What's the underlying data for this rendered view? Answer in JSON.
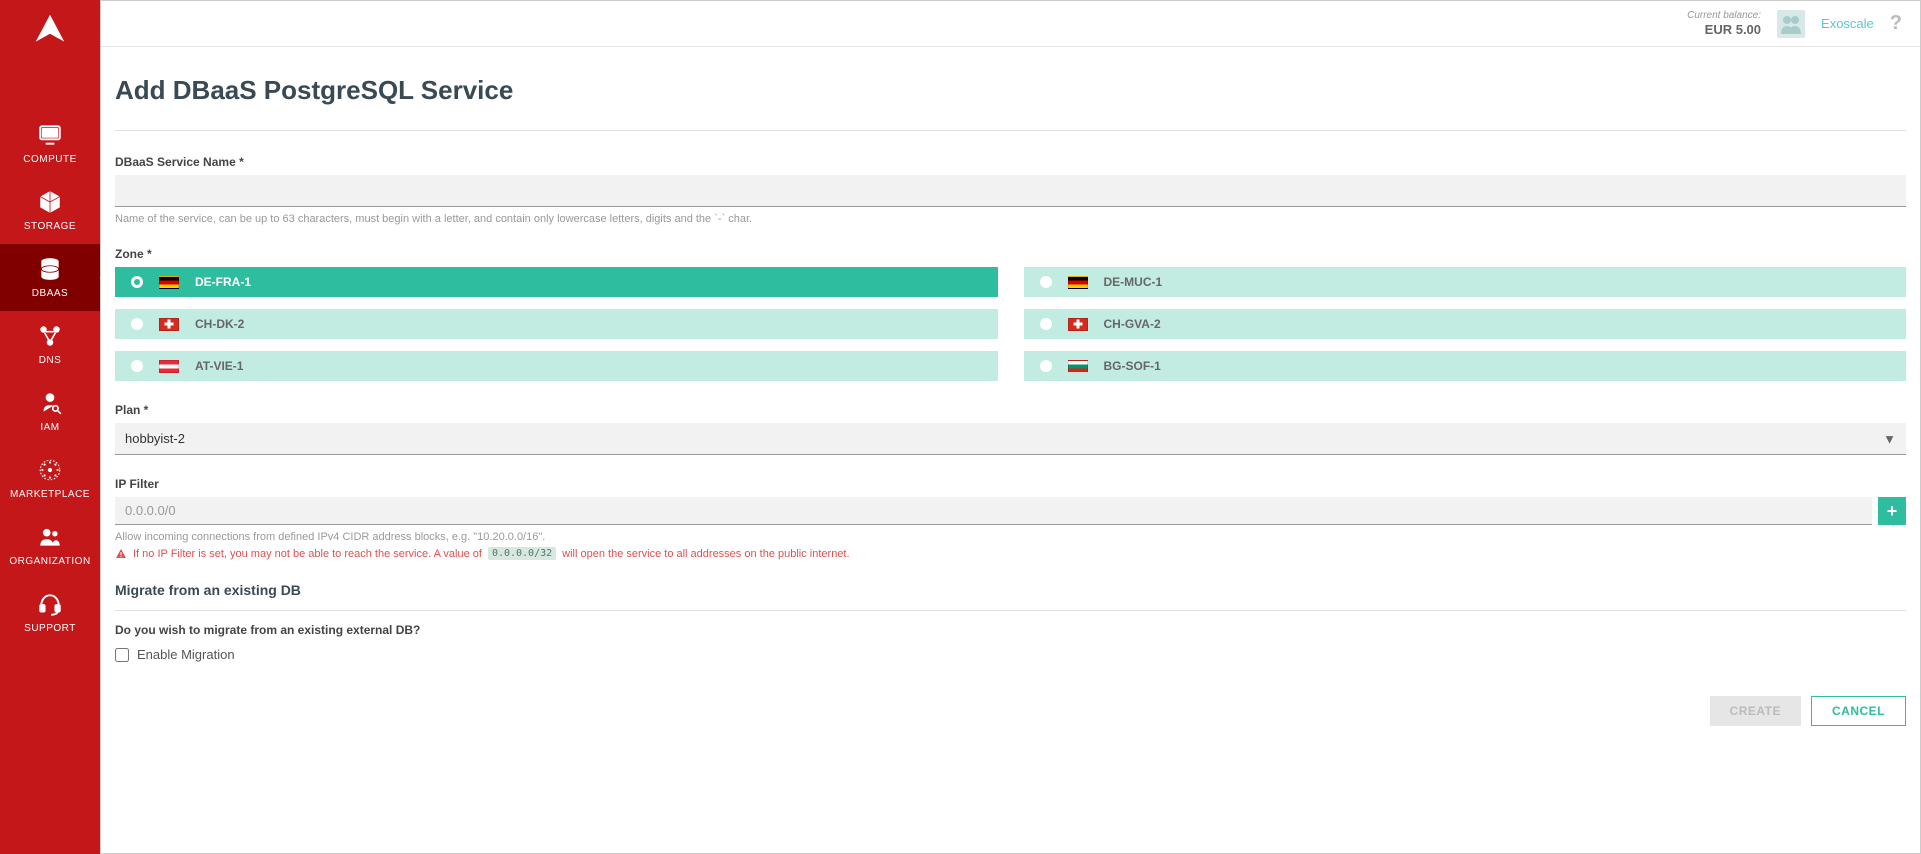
{
  "sidebar": {
    "items": [
      {
        "label": "COMPUTE",
        "name": "sidebar-item-compute"
      },
      {
        "label": "STORAGE",
        "name": "sidebar-item-storage"
      },
      {
        "label": "DBAAS",
        "name": "sidebar-item-dbaas"
      },
      {
        "label": "DNS",
        "name": "sidebar-item-dns"
      },
      {
        "label": "IAM",
        "name": "sidebar-item-iam"
      },
      {
        "label": "MARKETPLACE",
        "name": "sidebar-item-marketplace"
      },
      {
        "label": "ORGANIZATION",
        "name": "sidebar-item-organization"
      },
      {
        "label": "SUPPORT",
        "name": "sidebar-item-support"
      }
    ],
    "active_index": 2
  },
  "topbar": {
    "balance_label": "Current balance:",
    "balance_value": "EUR  5.00",
    "org_name": "Exoscale",
    "help": "?"
  },
  "page": {
    "title": "Add DBaaS PostgreSQL Service",
    "service_name": {
      "label": "DBaaS Service Name *",
      "value": "",
      "helper": "Name of the service, can be up to 63 characters, must begin with a letter, and contain only lowercase letters, digits and the `-` char."
    },
    "zone": {
      "label": "Zone *",
      "options": [
        {
          "code": "DE-FRA-1",
          "flag": "de",
          "selected": true
        },
        {
          "code": "DE-MUC-1",
          "flag": "de",
          "selected": false
        },
        {
          "code": "CH-DK-2",
          "flag": "ch",
          "selected": false
        },
        {
          "code": "CH-GVA-2",
          "flag": "ch",
          "selected": false
        },
        {
          "code": "AT-VIE-1",
          "flag": "at",
          "selected": false
        },
        {
          "code": "BG-SOF-1",
          "flag": "bg",
          "selected": false
        }
      ]
    },
    "plan": {
      "label": "Plan *",
      "value": "hobbyist-2"
    },
    "ip_filter": {
      "label": "IP Filter",
      "placeholder": "0.0.0.0/0",
      "helper": "Allow incoming connections from defined IPv4 CIDR address blocks, e.g. \"10.20.0.0/16\".",
      "warning_pre": "If no IP Filter is set, you may not be able to reach the service. A value of",
      "warning_code": "0.0.0.0/32",
      "warning_post": "will open the service to all addresses on the public internet."
    },
    "migrate": {
      "header": "Migrate from an existing DB",
      "question": "Do you wish to migrate from an existing external DB?",
      "checkbox_label": "Enable Migration",
      "checked": false
    },
    "actions": {
      "create": "CREATE",
      "cancel": "CANCEL"
    }
  }
}
